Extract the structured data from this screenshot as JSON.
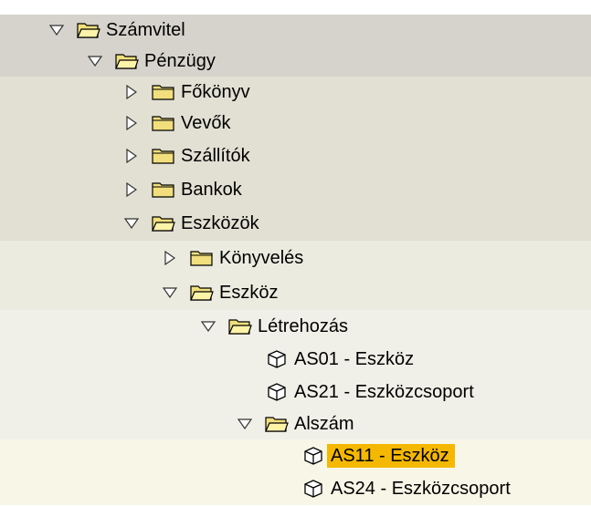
{
  "tree": {
    "items": [
      {
        "label": "Számvitel",
        "type": "folder",
        "expanded": true
      },
      {
        "label": "Pénzügy",
        "type": "folder",
        "expanded": true
      },
      {
        "label": "Főkönyv",
        "type": "folder",
        "expanded": false
      },
      {
        "label": "Vevők",
        "type": "folder",
        "expanded": false
      },
      {
        "label": "Szállítók",
        "type": "folder",
        "expanded": false
      },
      {
        "label": "Bankok",
        "type": "folder",
        "expanded": false
      },
      {
        "label": "Eszközök",
        "type": "folder",
        "expanded": true
      },
      {
        "label": "Könyvelés",
        "type": "folder",
        "expanded": false
      },
      {
        "label": "Eszköz",
        "type": "folder",
        "expanded": true
      },
      {
        "label": "Létrehozás",
        "type": "folder",
        "expanded": true
      },
      {
        "label": "AS01 - Eszköz",
        "type": "transaction"
      },
      {
        "label": "AS21 - Eszközcsoport",
        "type": "transaction"
      },
      {
        "label": "Alszám",
        "type": "folder",
        "expanded": true
      },
      {
        "label": "AS11 - Eszköz",
        "type": "transaction",
        "selected": true
      },
      {
        "label": "AS24 - Eszközcsoport",
        "type": "transaction"
      }
    ]
  },
  "colors": {
    "band_level1": "#d6d3cc",
    "band_level2": "#e2e0d3",
    "band_level3": "#ecebe0",
    "band_level4": "#f1f0e8",
    "band_level5": "#f8f6e7",
    "selection": "#f5b800",
    "folder_yellow": "#f1df7d",
    "folder_outline": "#000000"
  },
  "icons": {
    "expanded": "triangle-down-icon",
    "collapsed": "triangle-right-icon",
    "folder_open": "folder-open-icon",
    "folder_closed": "folder-closed-icon",
    "transaction": "cube-icon"
  }
}
